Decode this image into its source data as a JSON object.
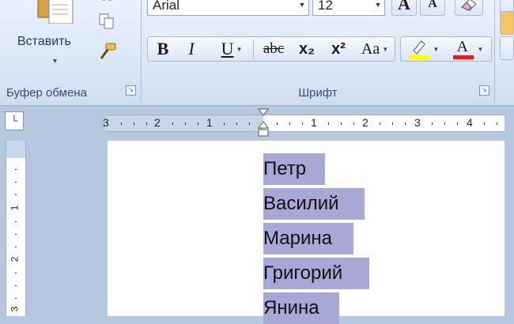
{
  "clipboard": {
    "paste_label": "Вставить",
    "group_label": "Буфер обмена"
  },
  "font": {
    "font_name": "Arial",
    "font_size": "12",
    "group_label": "Шрифт",
    "bold": "B",
    "italic": "I",
    "underline": "U",
    "strikethrough": "abc",
    "subscript": "x₂",
    "superscript": "x²",
    "change_case": "Aa",
    "grow": "A",
    "shrink": "A",
    "font_color_letter": "A"
  },
  "ruler": {
    "h_labels": [
      "3",
      "2",
      "1",
      "1",
      "2",
      "3",
      "4"
    ],
    "v_labels": [
      "1",
      "2",
      "3"
    ]
  },
  "document": {
    "lines": [
      "Петр",
      "Василий",
      "Марина",
      "Григорий",
      "Янина"
    ]
  },
  "colors": {
    "highlight": "#ffff00",
    "font_color": "#e02020",
    "selection": "#a7a8d6"
  }
}
